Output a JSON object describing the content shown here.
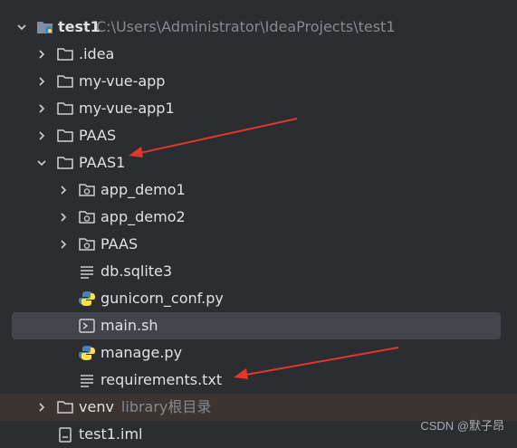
{
  "project": {
    "name": "test1",
    "path": "C:\\Users\\Administrator\\IdeaProjects\\test1"
  },
  "tree": {
    "idea": ".idea",
    "my_vue_app": "my-vue-app",
    "my_vue_app1": "my-vue-app1",
    "paas": "PAAS",
    "paas1": {
      "name": "PAAS1",
      "children": {
        "app_demo1": "app_demo1",
        "app_demo2": "app_demo2",
        "paas_pkg": "PAAS",
        "db": "db.sqlite3",
        "gunicorn": "gunicorn_conf.py",
        "main_sh": "main.sh",
        "manage": "manage.py",
        "requirements": "requirements.txt"
      }
    },
    "venv": {
      "name": "venv",
      "hint": "library根目录"
    },
    "iml": "test1.iml"
  },
  "selected_item": "main.sh",
  "watermark": "CSDN @默子昂",
  "colors": {
    "background": "#2b2d30",
    "selection": "#43454a",
    "excluded_row": "#3b3430",
    "arrow": "#e0372f",
    "python_blue": "#4584b6",
    "python_yellow": "#ffde57"
  },
  "icons": {
    "folder": "folder-icon",
    "package": "package-folder-icon",
    "text_file": "text-file-icon",
    "python_file": "python-file-icon",
    "shell_file": "shell-script-icon",
    "iml_file": "module-file-icon",
    "project": "project-module-icon"
  }
}
